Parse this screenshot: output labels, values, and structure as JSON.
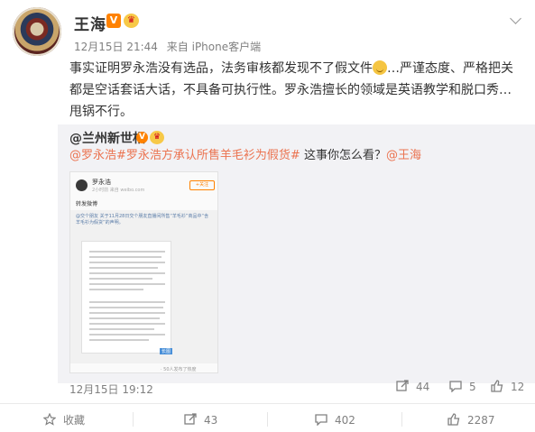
{
  "post": {
    "username": "王海",
    "badge_v": "V",
    "badge_crown": "♛",
    "date": "12月15日 21:44",
    "source_prefix": "来自",
    "source": "iPhone客户端",
    "text_1": "事实证明罗永浩没有选品，法务审核都发现不了假文件",
    "text_2": "…严谨态度、严格把关都是空话套话大话，不具备可执行性。罗永浩擅长的领域是英语教学和脱口秀…甩锅不行。"
  },
  "repost": {
    "username": "@兰州新世相",
    "badge_v": "V",
    "badge_crown": "♛",
    "link_1": "@罗永浩",
    "topic": "#罗永浩方承认所售羊毛衫为假货#",
    "question": " 这事你怎么看？",
    "link_2": "@王海",
    "date": "12月15日 19:12",
    "actions": {
      "repost_count": "44",
      "comment_count": "5",
      "like_count": "12"
    }
  },
  "thumbnail": {
    "name": "罗永浩",
    "sub": "2小时前  来自 weibo.com",
    "follow": "+关注",
    "repost_label": "转发微博",
    "quote": "@交个朋友 关于11月28日交个朋友直播间所售“羊毛衫”商品中“含羊毛衫为假货”的声明。",
    "badge": "长图",
    "footer": "· 50人发布了热度"
  },
  "bottom_bar": {
    "favorite_label": "收藏",
    "repost_count": "43",
    "comment_count": "402",
    "like_count": "2287"
  },
  "colors": {
    "accent_orange": "#ff8200",
    "link": "#eb7350",
    "muted": "#808080"
  },
  "icons": [
    "chevron-down-icon",
    "repost-icon",
    "comment-icon",
    "like-icon",
    "star-icon"
  ]
}
